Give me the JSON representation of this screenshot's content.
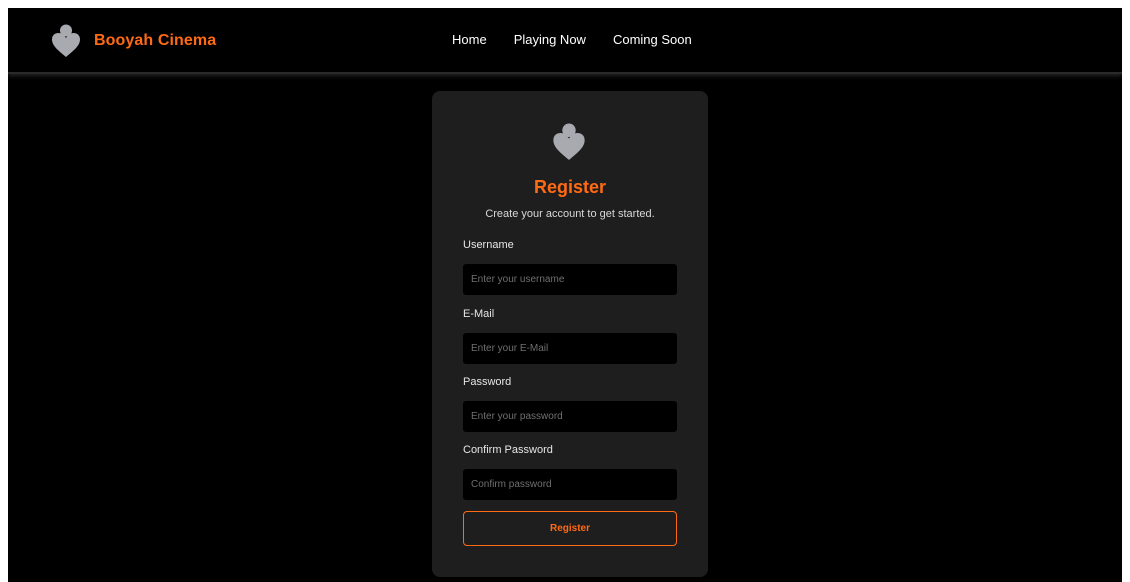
{
  "brand": {
    "name": "Booyah Cinema",
    "logo_icon": "heart-drop-icon",
    "accent_color": "#ff6a14"
  },
  "nav": {
    "links": [
      {
        "label": "Home"
      },
      {
        "label": "Playing Now"
      },
      {
        "label": "Coming Soon"
      }
    ]
  },
  "register_form": {
    "logo_icon": "heart-drop-icon",
    "title": "Register",
    "subtitle": "Create your account to get started.",
    "fields": [
      {
        "label": "Username",
        "placeholder": "Enter your username",
        "value": ""
      },
      {
        "label": "E-Mail",
        "placeholder": "Enter your E-Mail",
        "value": ""
      },
      {
        "label": "Password",
        "placeholder": "Enter your password",
        "value": ""
      },
      {
        "label": "Confirm Password",
        "placeholder": "Confirm password",
        "value": ""
      }
    ],
    "submit_label": "Register"
  },
  "colors": {
    "page_background": "#000000",
    "card_background": "#1e1e1e",
    "input_background": "#000000",
    "logo_gray": "#a8aab0"
  }
}
